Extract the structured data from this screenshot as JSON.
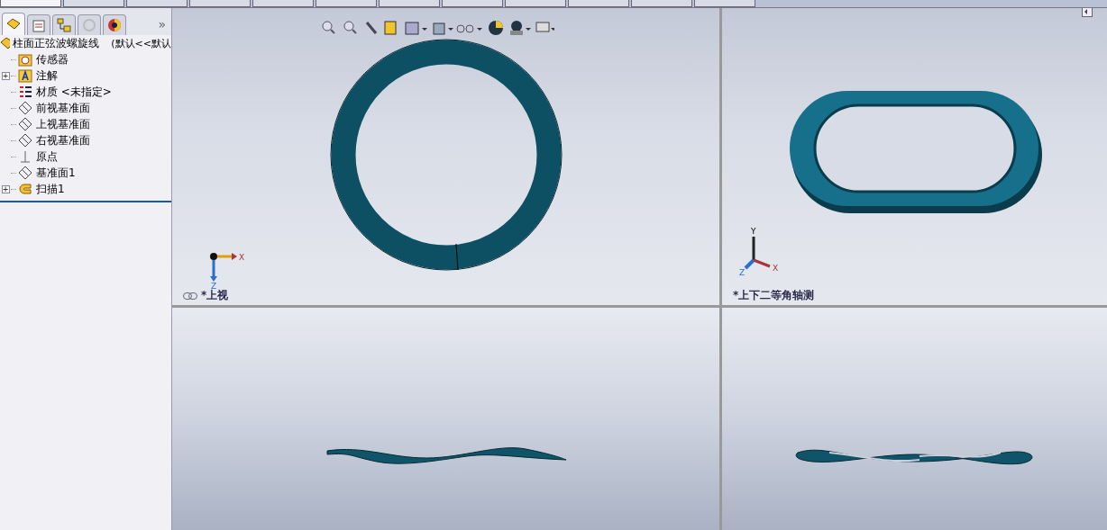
{
  "top_tabs": [
    {
      "selected": true
    },
    {
      "selected": false
    },
    {
      "selected": false
    },
    {
      "selected": false
    },
    {
      "selected": false
    },
    {
      "selected": false
    },
    {
      "selected": false
    },
    {
      "selected": false
    },
    {
      "selected": false
    },
    {
      "selected": false
    },
    {
      "selected": false
    },
    {
      "selected": false
    }
  ],
  "panel_tabs": [
    {
      "kind": "tree",
      "selected": true
    },
    {
      "kind": "property",
      "selected": false
    },
    {
      "kind": "config",
      "selected": false
    },
    {
      "kind": "dim",
      "selected": false
    },
    {
      "kind": "display",
      "selected": false
    }
  ],
  "panel_more": "»",
  "tree": {
    "root": {
      "label": "柱面正弦波螺旋线",
      "config": "(默认<<默认"
    },
    "items": [
      {
        "kind": "sensor",
        "label": "传感器"
      },
      {
        "kind": "annotation",
        "label": "注解",
        "expander": "+"
      },
      {
        "kind": "material",
        "label": "材质 <未指定>"
      },
      {
        "kind": "plane",
        "label": "前视基准面"
      },
      {
        "kind": "plane",
        "label": "上视基准面"
      },
      {
        "kind": "plane",
        "label": "右视基准面"
      },
      {
        "kind": "origin",
        "label": "原点"
      },
      {
        "kind": "plane",
        "label": "基准面1"
      },
      {
        "kind": "sweep",
        "label": "扫描1",
        "expander": "+"
      }
    ]
  },
  "viewports": [
    {
      "kind": "ring",
      "triad": {
        "kind": "top",
        "axes": [
          "X",
          "Z"
        ]
      },
      "label": "*上视",
      "linked": true
    },
    {
      "kind": "oval",
      "triad": {
        "kind": "iso",
        "axes": [
          "Y",
          "X",
          "Z"
        ]
      },
      "label": "*上下二等角轴测",
      "linked": false
    },
    {
      "kind": "wave"
    },
    {
      "kind": "twist"
    }
  ]
}
